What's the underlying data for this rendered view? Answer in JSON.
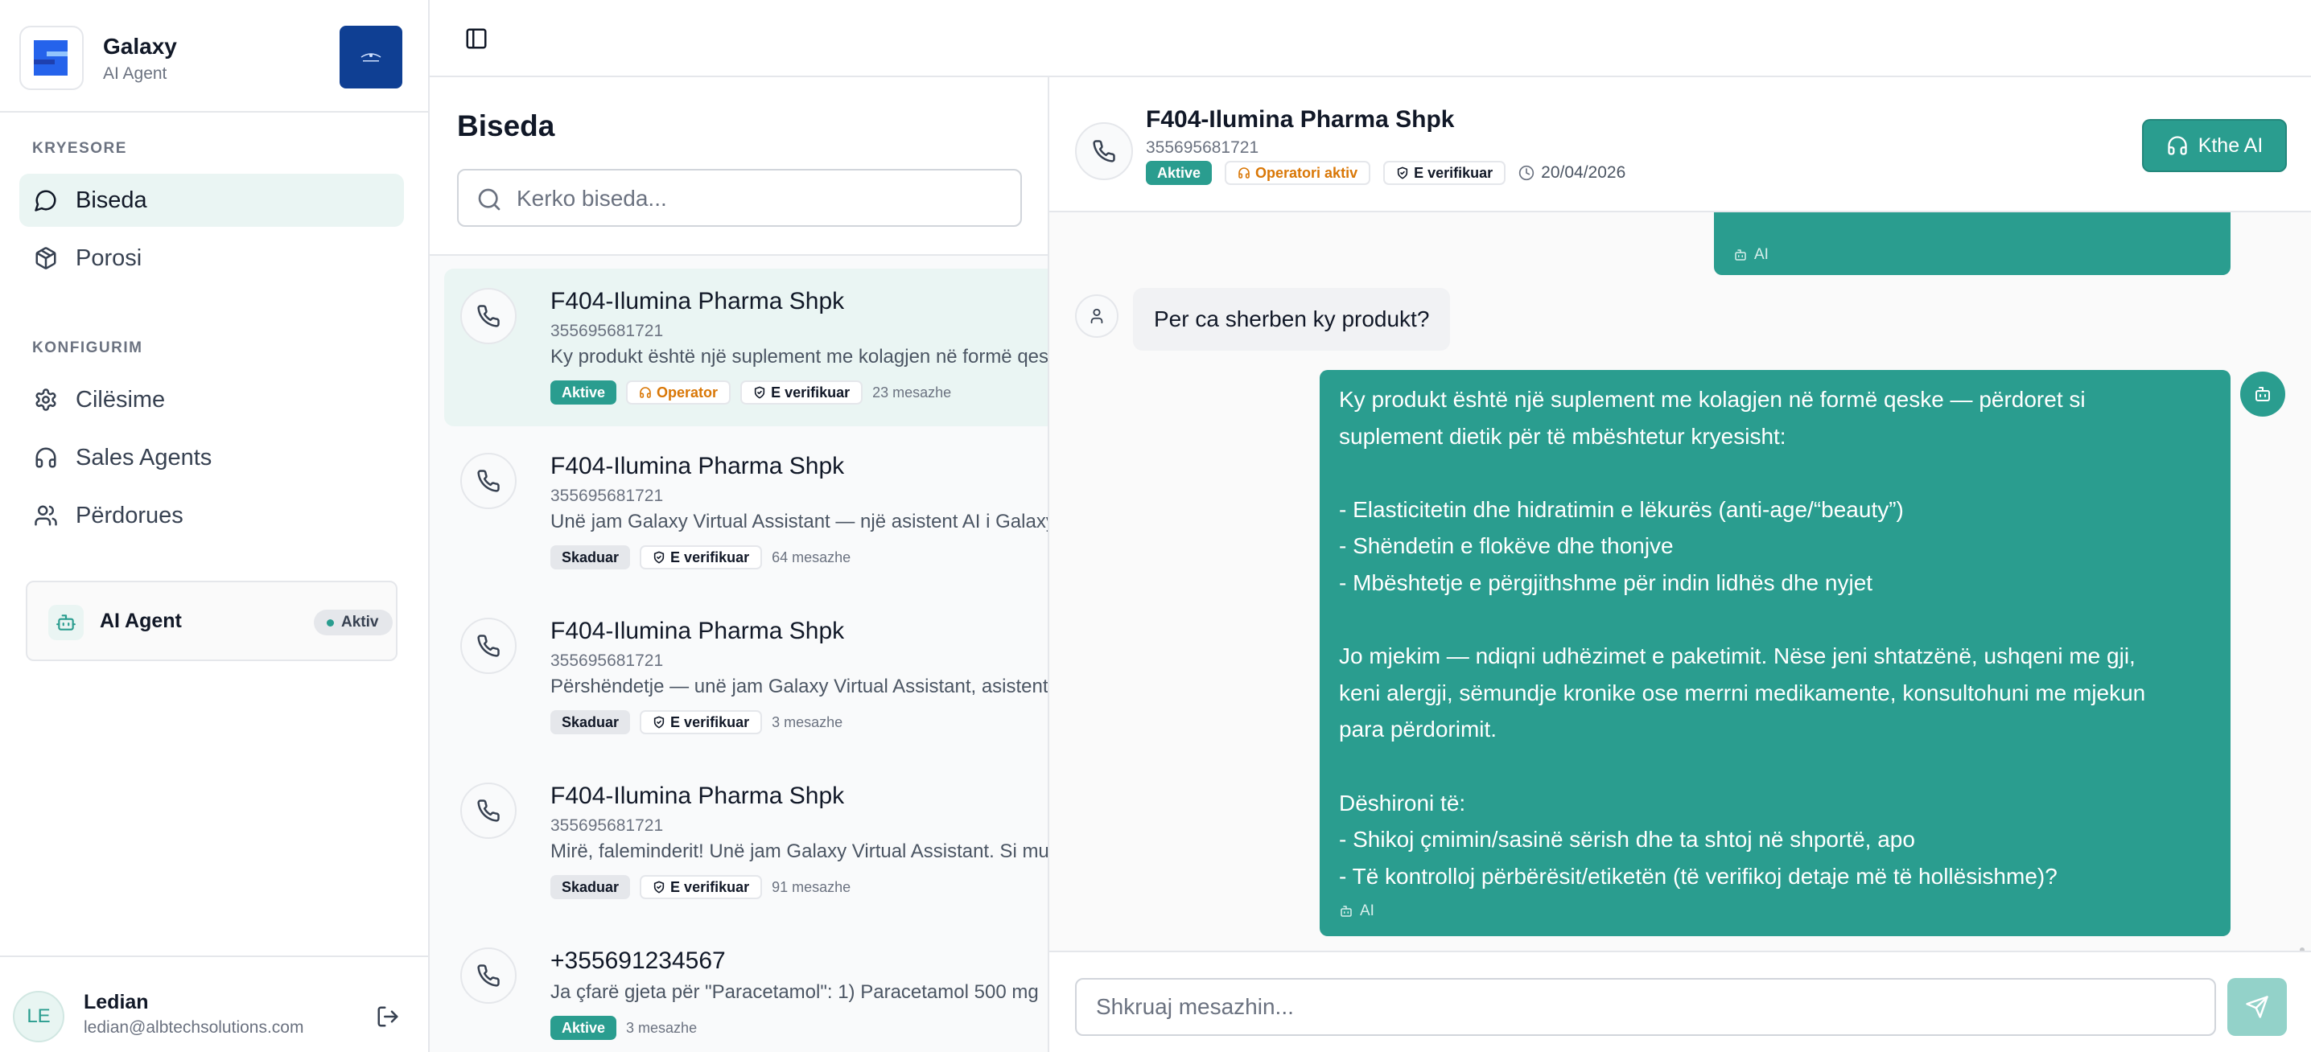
{
  "brand": {
    "title": "Galaxy",
    "subtitle": "AI Agent",
    "logo_icon": "galaxy-logo",
    "badge_icon": "company-crest"
  },
  "sidebar": {
    "section_main": "KRYESORE",
    "section_config": "KONFIGURIM",
    "items": [
      {
        "label": "Biseda",
        "icon": "chat-bubble-icon",
        "active": true
      },
      {
        "label": "Porosi",
        "icon": "package-icon",
        "active": false
      },
      {
        "label": "Cilësime",
        "icon": "gear-icon",
        "active": false
      },
      {
        "label": "Sales Agents",
        "icon": "headset-icon",
        "active": false
      },
      {
        "label": "Përdorues",
        "icon": "users-icon",
        "active": false
      }
    ],
    "agent_card": {
      "name": "AI Agent",
      "status": "Aktiv"
    },
    "user": {
      "initials": "LE",
      "name": "Ledian",
      "email": "ledian@albtechsolutions.com"
    }
  },
  "conversations": {
    "title": "Biseda",
    "search_placeholder": "Kerko biseda...",
    "items": [
      {
        "name": "F404-Ilumina Pharma Shpk",
        "phone": "355695681721",
        "preview": "Ky produkt është një suplement me kolagjen në formë qeske — përdoret si suplement dietik",
        "status": "Aktive",
        "operator": "Operator",
        "verified": "E verifikuar",
        "count": "23 mesazhe",
        "selected": true
      },
      {
        "name": "F404-Ilumina Pharma Shpk",
        "phone": "355695681721",
        "preview": "Unë jam Galaxy Virtual Assistant — një asistent AI i Galaxy Pharma",
        "status": "Skaduar",
        "verified": "E verifikuar",
        "count": "64 mesazhe"
      },
      {
        "name": "F404-Ilumina Pharma Shpk",
        "phone": "355695681721",
        "preview": "Përshëndetje — unë jam Galaxy Virtual Assistant, asistenti juaj",
        "status": "Skaduar",
        "verified": "E verifikuar",
        "count": "3 mesazhe"
      },
      {
        "name": "F404-Ilumina Pharma Shpk",
        "phone": "355695681721",
        "preview": "Mirë, faleminderit! Unë jam Galaxy Virtual Assistant. Si mund t'ju ndihmoj",
        "status": "Skaduar",
        "verified": "E verifikuar",
        "count": "91 mesazhe"
      },
      {
        "name": "+355691234567",
        "preview": "Ja çfarë gjeta për \"Paracetamol\": 1) Paracetamol 500 mg",
        "status": "Aktive",
        "count": "3 mesazhe"
      }
    ]
  },
  "chat": {
    "title": "F404-Ilumina Pharma Shpk",
    "phone": "355695681721",
    "status": "Aktive",
    "operator": "Operatori aktiv",
    "verified": "E verifikuar",
    "date": "20/04/2026",
    "return_ai_label": "Kthe AI",
    "ai_label": "AI",
    "user_message": "Per ca sherben ky produkt?",
    "ai_message_lines": [
      "Ky produkt është një suplement me kolagjen në formë qeske — përdoret si",
      "suplement dietik për të mbështetur kryesisht:",
      "",
      "- Elasticitetin dhe hidratimin e lëkurës (anti-age/“beauty”)",
      "- Shëndetin e flokëve dhe thonjve",
      "- Mbështetje e përgjithshme për indin lidhës dhe nyjet",
      "",
      "Jo mjekim — ndiqni udhëzimet e paketimit. Nëse jeni shtatzënë, ushqeni me gji,",
      "keni alergji, sëmundje kronike ose merrni medikamente, konsultohuni me mjekun",
      "para përdorimit.",
      "",
      "Dëshironi të:",
      "- Shikoj çmimin/sasinë sërish dhe ta shtoj në shportë, apo",
      "- Të kontrolloj përbërësit/etiketën (të verifikoj detaje më të hollësishme)?"
    ],
    "composer_placeholder": "Shkruaj mesazhin..."
  },
  "colors": {
    "accent": "#2a9d8f",
    "accent_light": "#eaf5f3",
    "operator": "#d97706",
    "badge_bg": "#0f3f93"
  }
}
